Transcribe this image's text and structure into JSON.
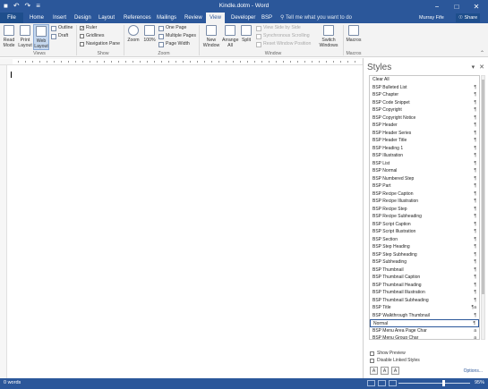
{
  "window": {
    "title": "Kindle.dotm - Word",
    "qat": [
      "■",
      "↶",
      "↷",
      "≡"
    ],
    "controls": [
      "−",
      "□",
      "✕"
    ]
  },
  "tabs": [
    {
      "label": "File",
      "active": false
    },
    {
      "label": "Home",
      "active": false
    },
    {
      "label": "Insert",
      "active": false
    },
    {
      "label": "Design",
      "active": false
    },
    {
      "label": "Layout",
      "active": false
    },
    {
      "label": "References",
      "active": false
    },
    {
      "label": "Mailings",
      "active": false
    },
    {
      "label": "Review",
      "active": false
    },
    {
      "label": "View",
      "active": true
    },
    {
      "label": "Developer",
      "active": false
    },
    {
      "label": "BSP",
      "active": false
    }
  ],
  "tell_me": "Tell me what you want to do",
  "user": "Murray Fife",
  "share_label": "Share",
  "ribbon": {
    "views": {
      "read_mode": "Read Mode",
      "print_layout": "Print Layout",
      "web_layout": "Web Layout",
      "outline": "Outline",
      "draft": "Draft",
      "label": "Views"
    },
    "show": {
      "ruler": "Ruler",
      "gridlines": "Gridlines",
      "navigation_pane": "Navigation Pane",
      "ruler_checked": true,
      "gridlines_checked": false,
      "navigation_checked": false,
      "label": "Show"
    },
    "zoom": {
      "zoom": "Zoom",
      "hundred": "100%",
      "one_page": "One Page",
      "multiple_pages": "Multiple Pages",
      "page_width": "Page Width",
      "label": "Zoom"
    },
    "window": {
      "new_window": "New Window",
      "arrange_all": "Arrange All",
      "split": "Split",
      "view_side_by_side": "View Side by Side",
      "synchronous_scrolling": "Synchronous Scrolling",
      "reset_window_position": "Reset Window Position",
      "switch_windows": "Switch Windows",
      "label": "Window"
    },
    "macros": {
      "macros": "Macros",
      "label": "Macros"
    }
  },
  "styles_pane": {
    "title": "Styles",
    "items": [
      {
        "name": "Clear All",
        "mark": ""
      },
      {
        "name": "BSP Bulleted List",
        "mark": "¶"
      },
      {
        "name": "BSP Chapter",
        "mark": "¶"
      },
      {
        "name": "BSP Code Snippet",
        "mark": "¶"
      },
      {
        "name": "BSP Copyright",
        "mark": "¶"
      },
      {
        "name": "BSP Copyright Notice",
        "mark": "¶"
      },
      {
        "name": "BSP Header",
        "mark": "¶"
      },
      {
        "name": "BSP Header Series",
        "mark": "¶"
      },
      {
        "name": "BSP Header Title",
        "mark": "¶"
      },
      {
        "name": "BSP Heading 1",
        "mark": "¶"
      },
      {
        "name": "BSP Illustration",
        "mark": "¶"
      },
      {
        "name": "BSP List",
        "mark": "¶"
      },
      {
        "name": "BSP Normal",
        "mark": "¶"
      },
      {
        "name": "BSP Numbered Step",
        "mark": "¶"
      },
      {
        "name": "BSP Part",
        "mark": "¶"
      },
      {
        "name": "BSP Recipe Caption",
        "mark": "¶"
      },
      {
        "name": "BSP Recipe Illustration",
        "mark": "¶"
      },
      {
        "name": "BSP Recipe Step",
        "mark": "¶"
      },
      {
        "name": "BSP Recipe Subheading",
        "mark": "¶"
      },
      {
        "name": "BSP Script Caption",
        "mark": "¶"
      },
      {
        "name": "BSP Script Illustration",
        "mark": "¶"
      },
      {
        "name": "BSP Section",
        "mark": "¶"
      },
      {
        "name": "BSP Step Heading",
        "mark": "¶"
      },
      {
        "name": "BSP Step Subheading",
        "mark": "¶"
      },
      {
        "name": "BSP Subheading",
        "mark": "¶"
      },
      {
        "name": "BSP Thumbnail",
        "mark": "¶"
      },
      {
        "name": "BSP Thumbnail Caption",
        "mark": "¶"
      },
      {
        "name": "BSP Thumbnail Heading",
        "mark": "¶"
      },
      {
        "name": "BSP Thumbnail Illustration",
        "mark": "¶"
      },
      {
        "name": "BSP Thumbnail Subheading",
        "mark": "¶"
      },
      {
        "name": "BSP Title",
        "mark": "¶a"
      },
      {
        "name": "BSP Walkthrough Thumbnail",
        "mark": "¶"
      },
      {
        "name": "Normal",
        "mark": "¶",
        "selected": true
      },
      {
        "name": "BSP Menu Area Page Char",
        "mark": "a"
      },
      {
        "name": "BSP Menu Group Char",
        "mark": "a"
      }
    ],
    "show_preview": "Show Preview",
    "disable_linked_styles": "Disable Linked Styles",
    "options": "Options..."
  },
  "status": {
    "words": "0 words",
    "zoom_percent": "95%",
    "zoom_level": 0.62
  },
  "colors": {
    "brand": "#2b579a",
    "ribbon_bg": "#f3f3f3"
  }
}
